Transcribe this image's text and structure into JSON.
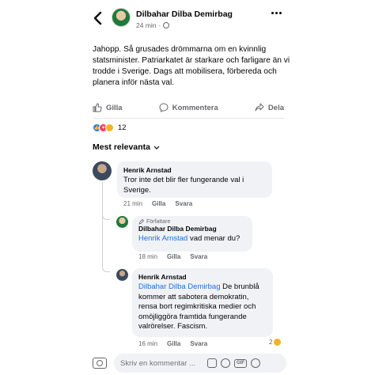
{
  "post": {
    "author": "Dilbahar Dilba Demirbag",
    "time": "24 min",
    "text": "Jahopp. Så grusades drömmarna om en kvinnlig statsminister. Patriarkatet är starkare och farligare än vi trodde i Sverige. Dags att mobilisera, förbereda och planera inför nästa val."
  },
  "actions": {
    "like": "Gilla",
    "comment": "Kommentera",
    "share": "Dela"
  },
  "reactions": {
    "count": "12"
  },
  "sort": {
    "label": "Mest relevanta"
  },
  "comments": [
    {
      "author": "Henrik Arnstad",
      "text": "Tror inte det blir fler fungerande val i Sverige.",
      "time": "21 min",
      "like": "Gilla",
      "reply": "Svara"
    },
    {
      "tag": "Författare",
      "author": "Dilbahar Dilba Demirbag",
      "mention": "Henrik Arnstad",
      "text": " vad menar du?",
      "time": "18 min",
      "like": "Gilla",
      "reply": "Svara"
    },
    {
      "author": "Henrik Arnstad",
      "mention": "Dilbahar Dilba Demirbag",
      "text": " De brunblå kommer att sabotera demokratin, rensa bort regimkritiska medier och omöjliggöra framtida fungerande valrörelser. Fascism.",
      "time": "16 min",
      "like": "Gilla",
      "reply": "Svara",
      "reaction_count": "2"
    }
  ],
  "composer": {
    "placeholder": "Skriv en kommentar ..."
  },
  "colors": {
    "link": "#216fdb",
    "bubble": "#f0f2f5",
    "secondary_text": "#65676b"
  }
}
